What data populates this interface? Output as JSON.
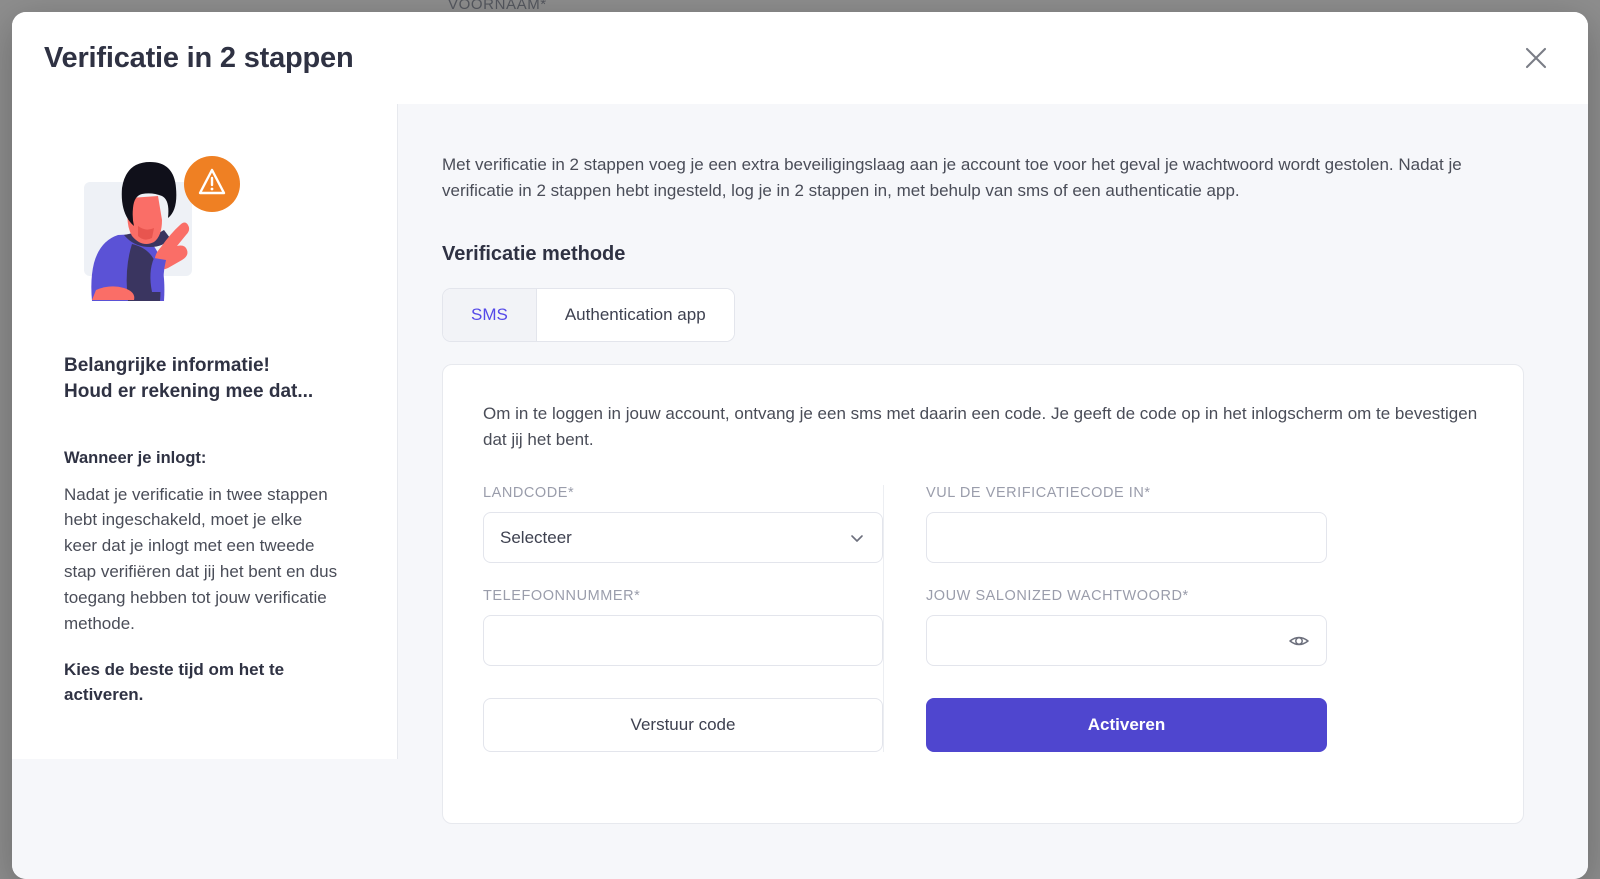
{
  "background": {
    "partial_label": "VOORNAAM*",
    "overlay_color": "#8e8e8e"
  },
  "modal": {
    "title": "Verificatie in 2 stappen",
    "close_icon": "close-icon"
  },
  "sidebar": {
    "illustration_name": "woman-pointing-warning-illustration",
    "heading": "Belangrijke informatie!\nHoud er rekening mee dat...",
    "subheading": "Wanneer je inlogt:",
    "paragraph": "Nadat je verificatie in twee stappen hebt ingeschakeld, moet je elke keer dat je inlogt met een tweede stap verifiëren dat jij het bent en dus toegang hebben tot jouw verificatie methode.",
    "bold_note": "Kies de beste tijd om het te activeren."
  },
  "content": {
    "intro": "Met verificatie in 2 stappen voeg je een extra beveiligingslaag aan je account toe voor het geval je wachtwoord wordt gestolen. Nadat je verificatie in 2 stappen hebt ingesteld, log je in 2 stappen in, met behulp van sms of een authenticatie app.",
    "section_title": "Verificatie methode",
    "tabs": [
      {
        "label": "SMS",
        "active": true
      },
      {
        "label": "Authentication app",
        "active": false
      }
    ],
    "panel": {
      "description": "Om in te loggen in jouw account, ontvang je een sms met daarin een code. Je geeft de code op in het inlogscherm om te bevestigen dat jij het bent.",
      "fields": {
        "country_code": {
          "label": "LANDCODE*",
          "value": "Selecteer",
          "icon": "chevron-down-icon"
        },
        "phone_number": {
          "label": "TELEFOONNUMMER*",
          "value": ""
        },
        "verification_code": {
          "label": "VUL DE VERIFICATIECODE IN*",
          "value": ""
        },
        "password": {
          "label": "JOUW SALONIZED WACHTWOORD*",
          "value": "",
          "icon": "eye-icon"
        }
      },
      "buttons": {
        "send_code": "Verstuur code",
        "activate": "Activeren"
      }
    }
  },
  "colors": {
    "primary": "#4f46cf",
    "accent_link": "#5448e8",
    "warning": "#ef8023",
    "text_dark": "#2f3243",
    "text_muted": "#9a9dab"
  }
}
